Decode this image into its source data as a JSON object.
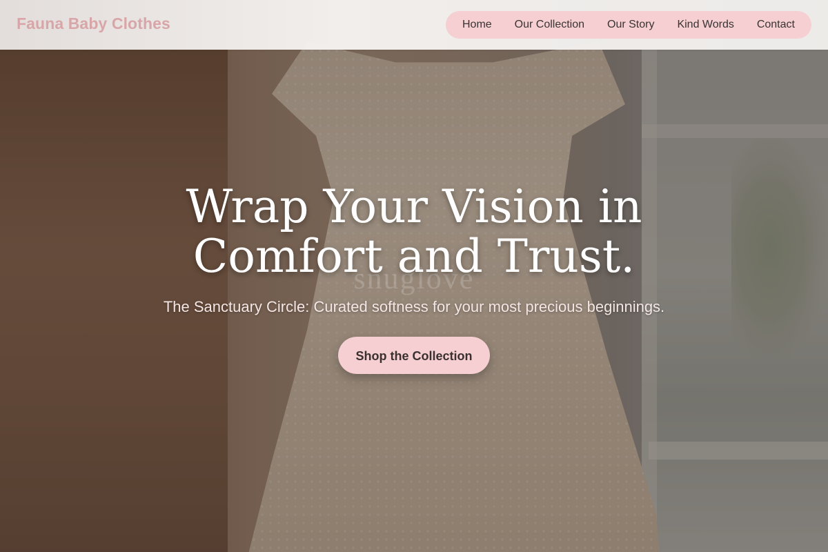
{
  "header": {
    "brand": "Fauna Baby Clothes",
    "nav": [
      {
        "label": "Home"
      },
      {
        "label": "Our Collection"
      },
      {
        "label": "Our Story"
      },
      {
        "label": "Kind Words"
      },
      {
        "label": "Contact"
      }
    ]
  },
  "hero": {
    "title_line_1": "Wrap Your Vision in",
    "title_line_2": "Comfort and Trust.",
    "subtitle": "The Sanctuary Circle: Curated softness for your most precious beginnings.",
    "cta_label": "Shop the Collection",
    "watermark": "snuglove"
  },
  "colors": {
    "accent_pink": "#f5cfd1",
    "brand_text": "#d8a6a8",
    "nav_text": "#3a3333"
  }
}
